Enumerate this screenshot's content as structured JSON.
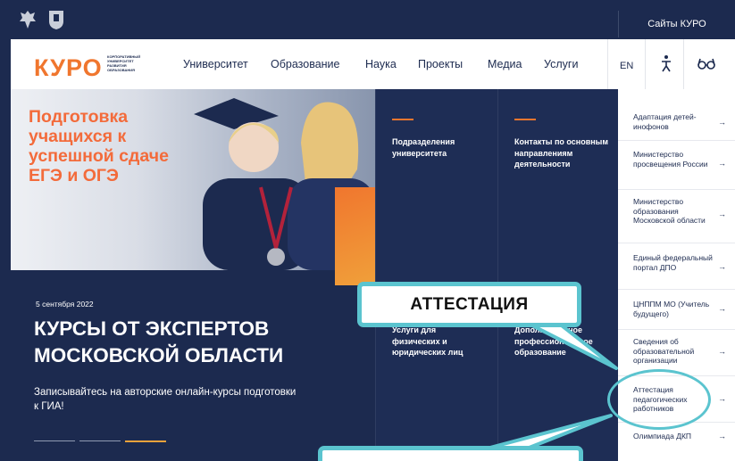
{
  "header": {
    "sites_label": "Сайты КУРО"
  },
  "logo": {
    "text": "КУРО",
    "subtitle": "КОРПОРАТИВНЫЙ УНИВЕРСИТЕТ РАЗВИТИЯ ОБРАЗОВАНИЯ"
  },
  "nav": {
    "items": [
      "Университет",
      "Образование",
      "Наука",
      "Проекты",
      "Медиа",
      "Услуги"
    ],
    "lang": "EN"
  },
  "hero": {
    "title": "Подготовка учащихся к успешной сдаче ЕГЭ и ОГЭ",
    "date": "5 сентября 2022",
    "headline": "КУРСЫ ОТ ЭКСПЕРТОВ МОСКОВСКОЙ ОБЛАСТИ",
    "text": "Записывайтесь на авторские онлайн-курсы подготовки к ГИА!"
  },
  "tiles": [
    {
      "label": "Подразделения университета"
    },
    {
      "label": "Контакты по основным направлениям деятельности"
    },
    {
      "label": "Услуги для физических и юридических лиц"
    },
    {
      "label": "Дополнительное профессиональное образование"
    }
  ],
  "sidebar": {
    "items": [
      {
        "label": "Адаптация детей-инофонов"
      },
      {
        "label": "Министерство просвещения России"
      },
      {
        "label": "Министерство образования Московской области"
      },
      {
        "label": "Единый федеральный портал ДПО"
      },
      {
        "label": "ЦНППМ МО (Учитель будущего)"
      },
      {
        "label": "Сведения об образовательной организации"
      },
      {
        "label": "Аттестация педагогических работников"
      },
      {
        "label": "Олимпиада ДКП"
      }
    ],
    "arrow": "→"
  },
  "callouts": {
    "main": "АТТЕСТАЦИЯ",
    "secondary": ""
  },
  "colors": {
    "navy": "#1c2a4f",
    "orange": "#f0762e",
    "callout_border": "#5bc4cf"
  }
}
